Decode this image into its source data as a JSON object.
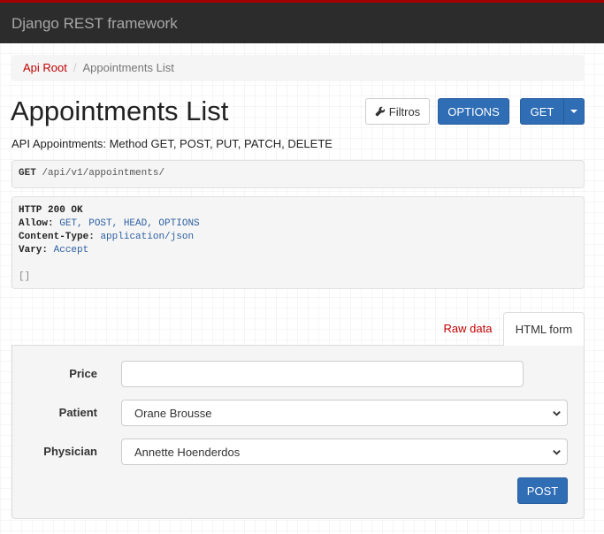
{
  "navbar": {
    "brand": "Django REST framework"
  },
  "breadcrumb": {
    "root": "Api Root",
    "separator": "/",
    "current": "Appointments List"
  },
  "page": {
    "title": "Appointments List",
    "description": "API Appointments: Method GET, POST, PUT, PATCH, DELETE"
  },
  "toolbar": {
    "filters_label": "Filtros",
    "options_label": "OPTIONS",
    "get_label": "GET"
  },
  "request": {
    "method": "GET",
    "path": "/api/v1/appointments/"
  },
  "response": {
    "status": "HTTP 200 OK",
    "headers": [
      {
        "key": "Allow:",
        "value": "GET, POST, HEAD, OPTIONS"
      },
      {
        "key": "Content-Type:",
        "value": "application/json"
      },
      {
        "key": "Vary:",
        "value": "Accept"
      }
    ],
    "body": "[]"
  },
  "tabs": {
    "raw": "Raw data",
    "html": "HTML form"
  },
  "form": {
    "price_label": "Price",
    "price_value": "",
    "patient_label": "Patient",
    "patient_selected": "Orane Brousse",
    "physician_label": "Physician",
    "physician_selected": "Annette Hoenderdos",
    "submit_label": "POST"
  },
  "colors": {
    "navbar_bg": "#2c2c2c",
    "accent_red": "#a30000",
    "link": "#c20000",
    "primary": "#2f6db5"
  }
}
